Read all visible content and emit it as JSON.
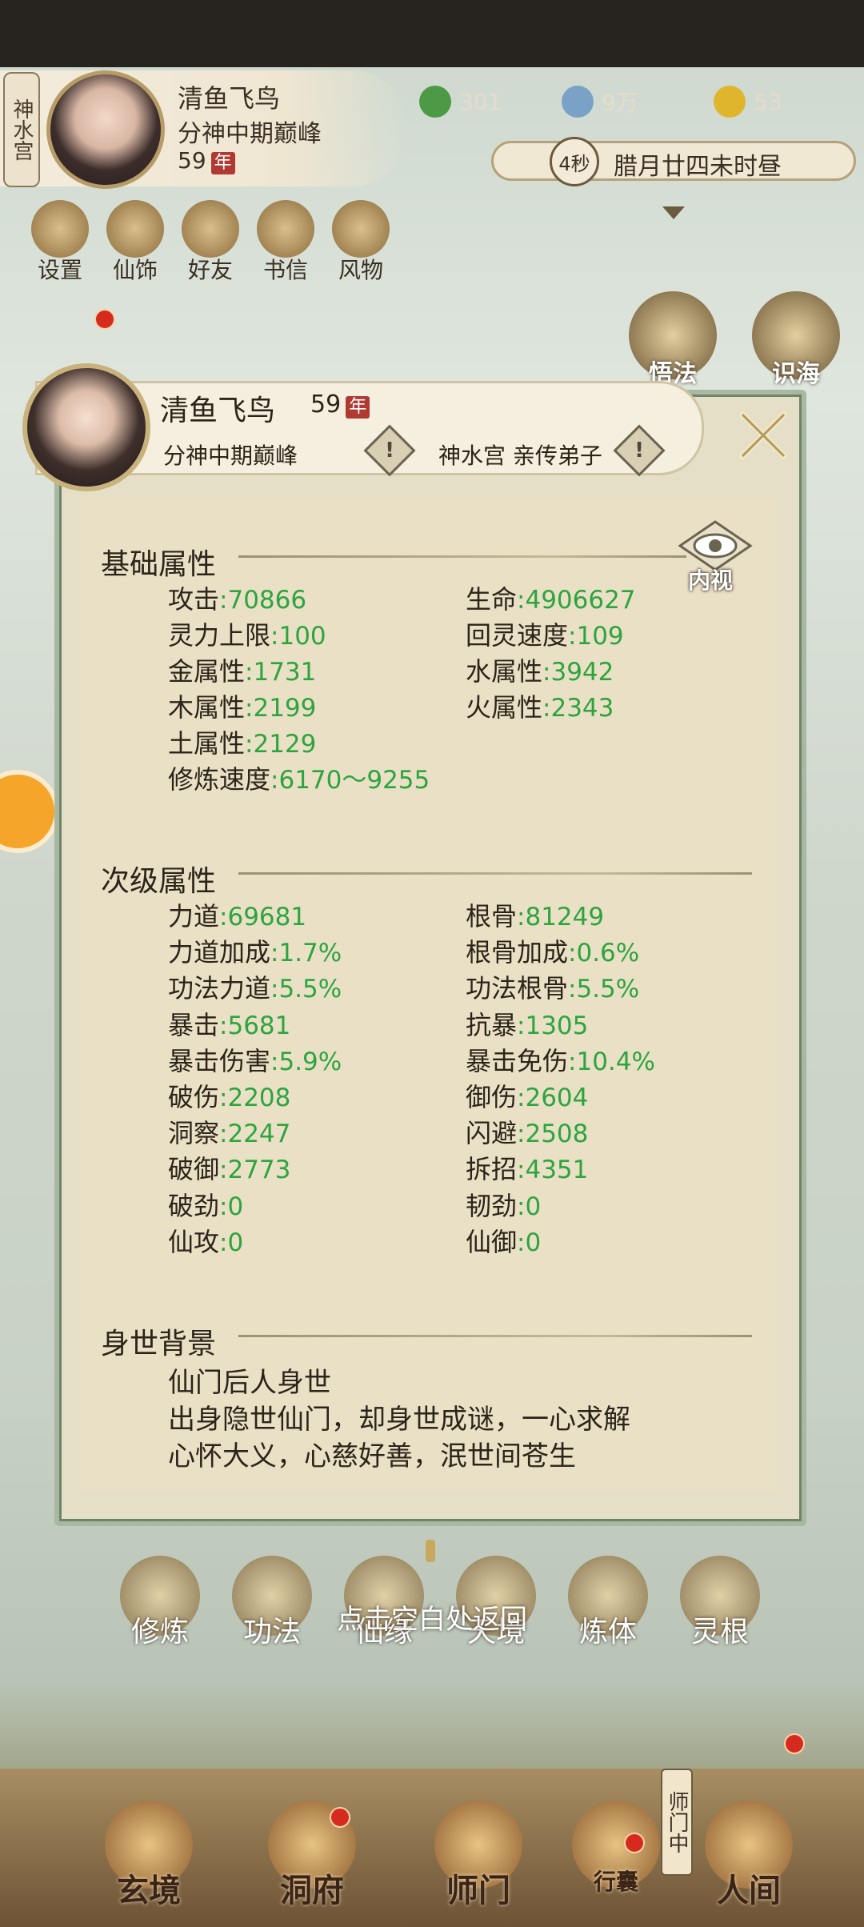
{
  "top": {
    "sect_tag": "神水宫",
    "name": "清鱼飞鸟",
    "realm": "分神中期巅峰",
    "age": "59",
    "age_unit": "年",
    "res_1": "301",
    "res_2": "9万",
    "res_3": "53",
    "timer": "4秒",
    "time_text": "腊月廿四未时昼"
  },
  "top_icons": [
    "设置",
    "仙饰",
    "好友",
    "书信",
    "风物"
  ],
  "side_icons": [
    "悟法",
    "识海"
  ],
  "dialog": {
    "name": "清鱼飞鸟",
    "age": "59",
    "age_unit": "年",
    "realm": "分神中期巅峰",
    "sect": "神水宫 亲传弟子",
    "inner_view": "内视",
    "basic_title": "基础属性",
    "basic": [
      {
        "l": "攻击",
        "v": "70866"
      },
      {
        "l": "生命",
        "v": "4906627"
      },
      {
        "l": "灵力上限",
        "v": "100"
      },
      {
        "l": "回灵速度",
        "v": "109"
      },
      {
        "l": "金属性",
        "v": "1731"
      },
      {
        "l": "水属性",
        "v": "3942"
      },
      {
        "l": "木属性",
        "v": "2199"
      },
      {
        "l": "火属性",
        "v": "2343"
      },
      {
        "l": "土属性",
        "v": "2129"
      },
      {
        "l": "修炼速度",
        "v": "6170～9255"
      }
    ],
    "secondary_title": "次级属性",
    "secondary": [
      {
        "l": "力道",
        "v": "69681"
      },
      {
        "l": "根骨",
        "v": "81249"
      },
      {
        "l": "力道加成",
        "v": "1.7%"
      },
      {
        "l": "根骨加成",
        "v": "0.6%"
      },
      {
        "l": "功法力道",
        "v": "5.5%"
      },
      {
        "l": "功法根骨",
        "v": "5.5%"
      },
      {
        "l": "暴击",
        "v": "5681"
      },
      {
        "l": "抗暴",
        "v": "1305"
      },
      {
        "l": "暴击伤害",
        "v": "5.9%"
      },
      {
        "l": "暴击免伤",
        "v": "10.4%"
      },
      {
        "l": "破伤",
        "v": "2208"
      },
      {
        "l": "御伤",
        "v": "2604"
      },
      {
        "l": "洞察",
        "v": "2247"
      },
      {
        "l": "闪避",
        "v": "2508"
      },
      {
        "l": "破御",
        "v": "2773"
      },
      {
        "l": "拆招",
        "v": "4351"
      },
      {
        "l": "破劲",
        "v": "0"
      },
      {
        "l": "韧劲",
        "v": "0"
      },
      {
        "l": "仙攻",
        "v": "0"
      },
      {
        "l": "仙御",
        "v": "0"
      }
    ],
    "background_title": "身世背景",
    "background_lines": [
      "仙门后人身世",
      "出身隐世仙门，却身世成谜，一心求解",
      "心怀大义，心慈好善，泯世间苍生"
    ]
  },
  "mid_nav": [
    "修炼",
    "功法",
    "仙缘",
    "天境",
    "炼体",
    "灵根"
  ],
  "hint": "点击空白处返回",
  "bottom_nav": [
    "玄境",
    "洞府",
    "师门",
    "行囊",
    "人间"
  ],
  "bottom_badge": "师门中"
}
